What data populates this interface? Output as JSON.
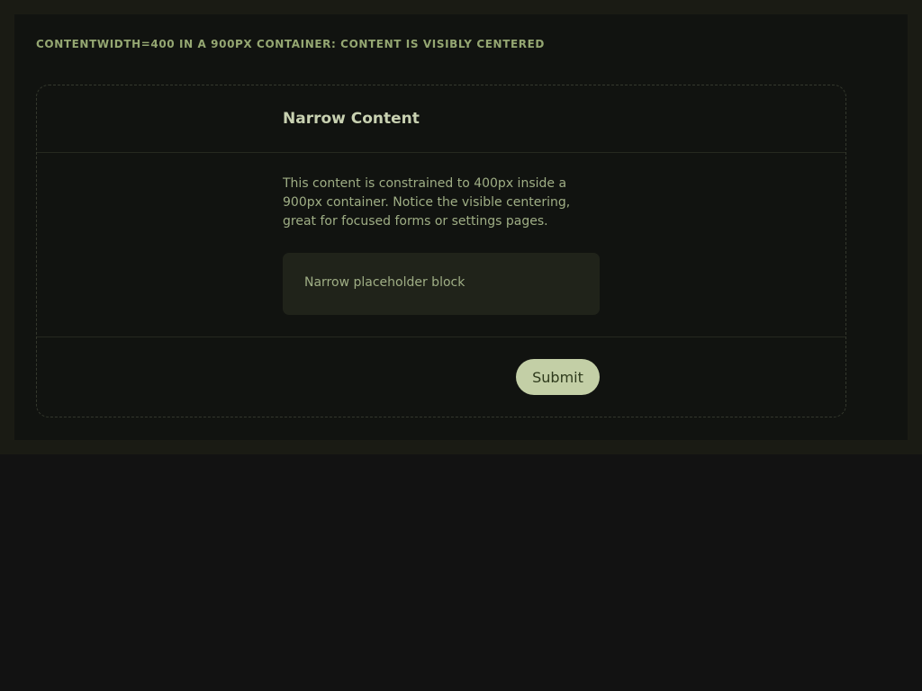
{
  "caption": "CONTENTWIDTH=400 IN A 900PX CONTAINER: CONTENT IS VISIBLY CENTERED",
  "card": {
    "title": "Narrow Content",
    "description": "This content is constrained to 400px inside a 900px container. Notice the visible centering, great for focused forms or settings pages.",
    "placeholder": "Narrow placeholder block",
    "submit_label": "Submit"
  },
  "colors": {
    "page_background": "#121212",
    "frame_background": "#1a1b14",
    "panel_background": "#111310",
    "caption_text": "#95a772",
    "title_text": "#c8d1b1",
    "body_text": "#9fae85",
    "placeholder_background": "#20231a",
    "button_background": "#c3cfa6",
    "button_text": "#2e3a1c"
  }
}
